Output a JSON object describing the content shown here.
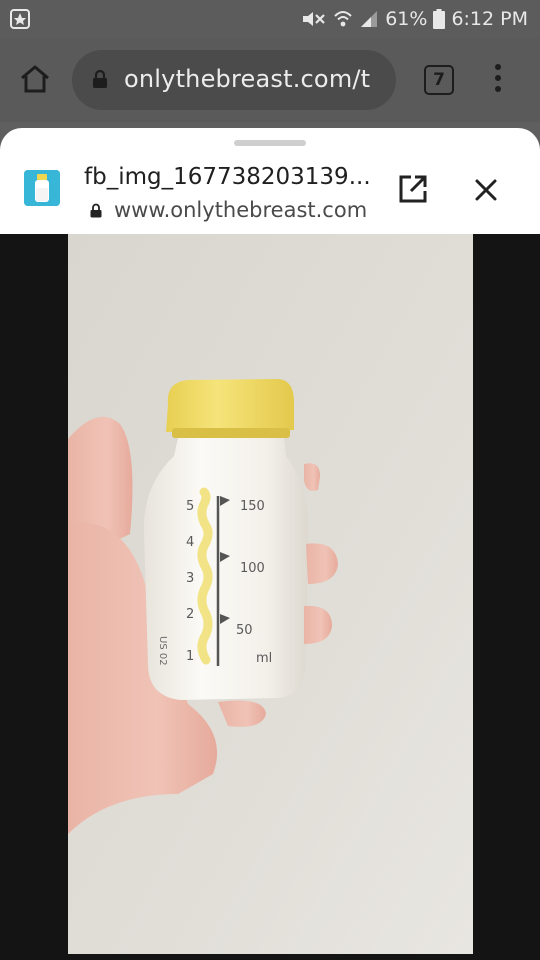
{
  "status_bar": {
    "battery_percent": "61%",
    "time": "6:12 PM",
    "icons": [
      "app-notification-icon",
      "mute-icon",
      "wifi-icon",
      "signal-icon",
      "battery-icon"
    ]
  },
  "browser": {
    "url": "onlythebreast.com/t",
    "tab_count": "7"
  },
  "preview_sheet": {
    "title": "fb_img_167738203139...",
    "url": "www.onlythebreast.com"
  },
  "photo": {
    "bottle_marks_left": [
      "5",
      "4",
      "3",
      "2",
      "1"
    ],
    "bottle_marks_right": [
      "150",
      "100",
      "50"
    ],
    "unit": "ml",
    "code": "US 02"
  },
  "colors": {
    "status_bar": "#5c5c5c",
    "toolbar": "#5a5a5a",
    "sheet_background": "#ffffff",
    "favicon": "#37b6d8",
    "bottle_cap": "#f2dd63",
    "wall": "#dcd9d2"
  }
}
